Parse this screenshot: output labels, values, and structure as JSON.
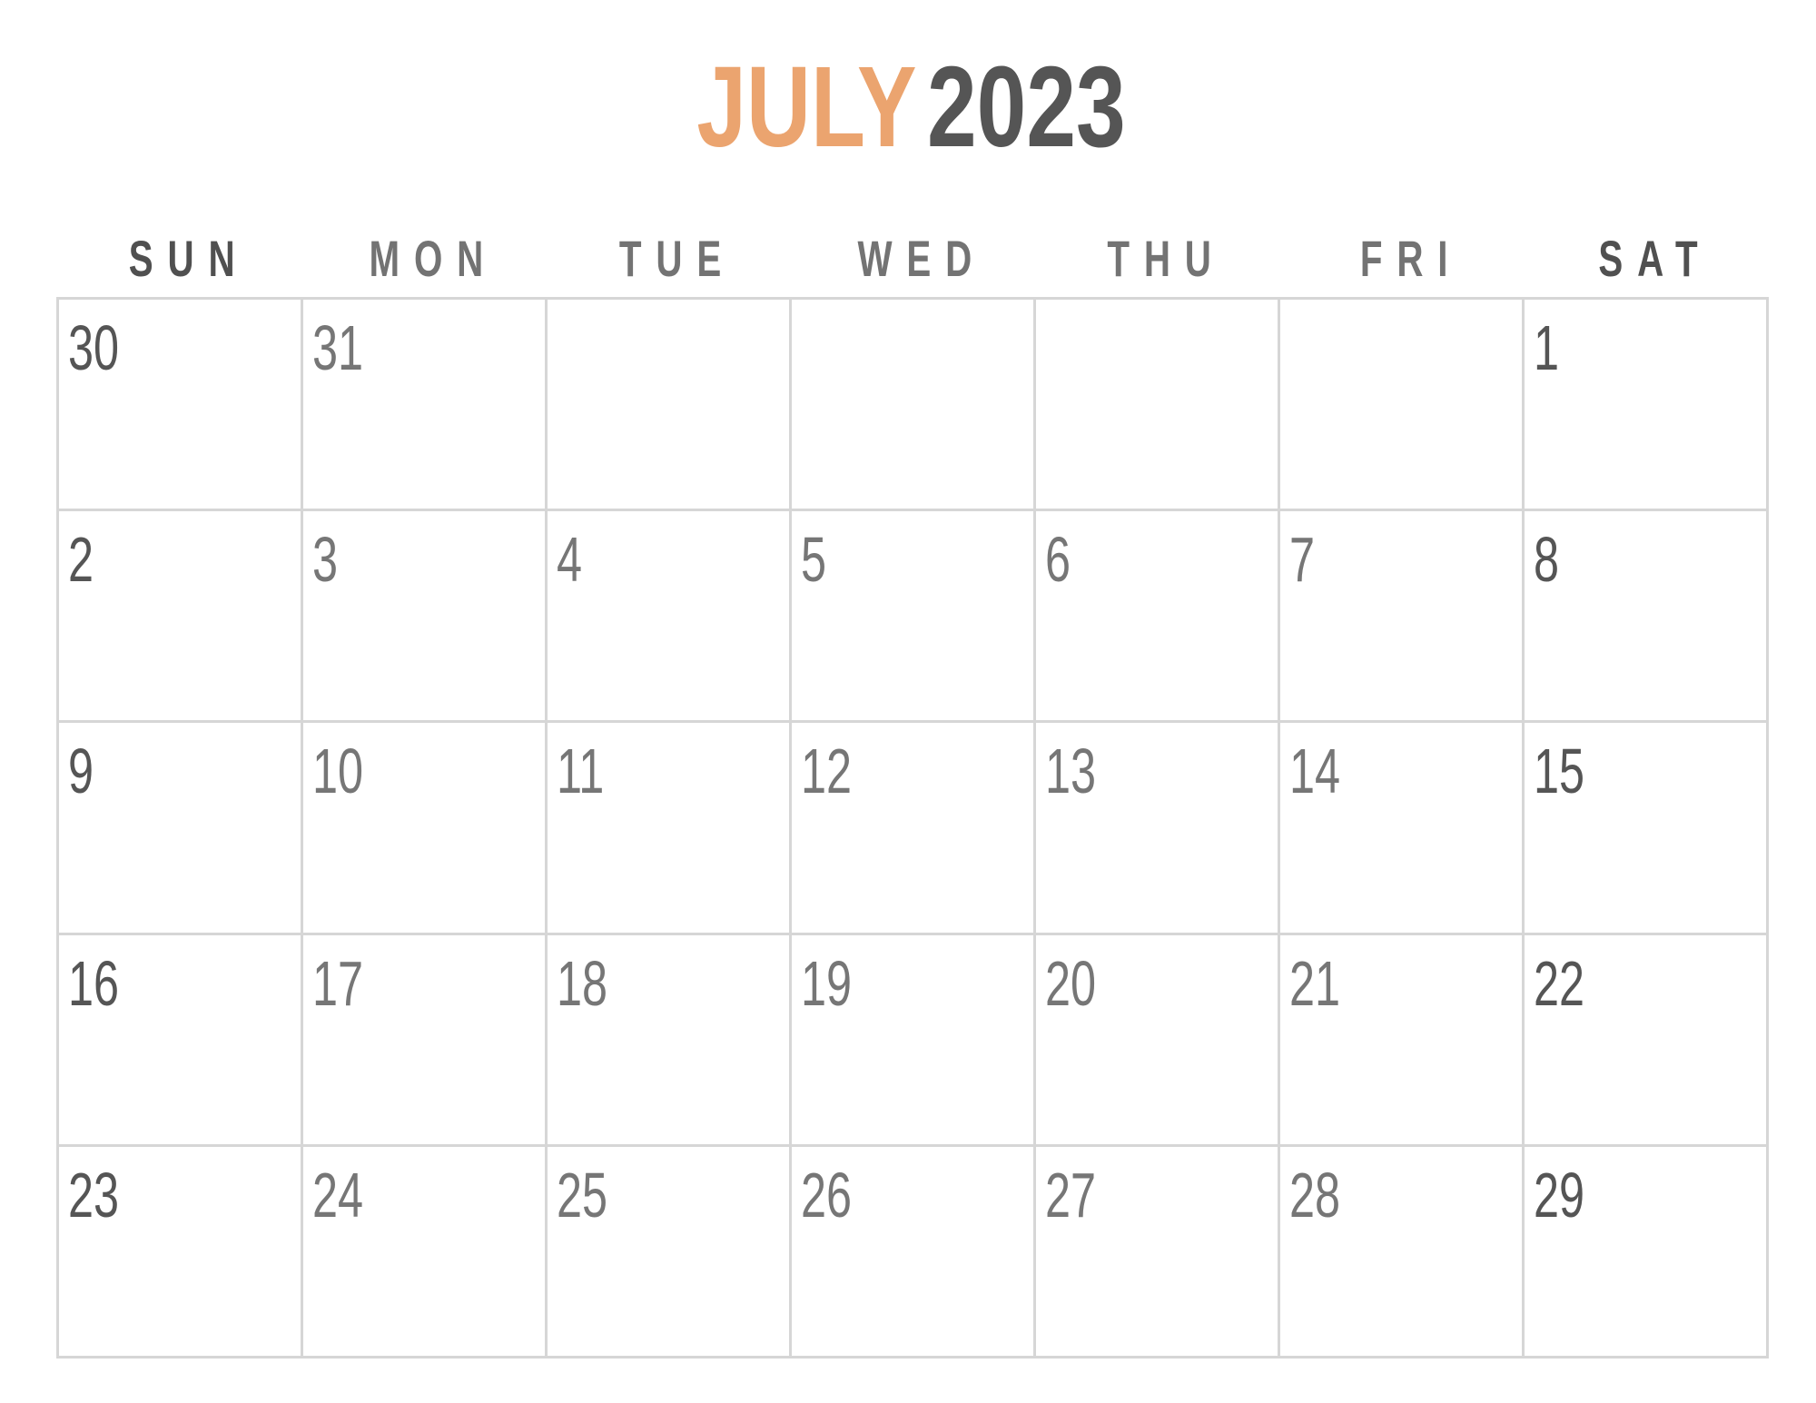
{
  "header": {
    "month": "JULY",
    "year": "2023"
  },
  "colors": {
    "month": "#eba46f",
    "year": "#555555",
    "weekday_dark": "#505050",
    "weekday_light": "#737373",
    "grid_line": "#d6d6d6",
    "day_dark": "#555555",
    "day_light": "#767676"
  },
  "weekdays": [
    {
      "label": "SUN",
      "tone": "dark"
    },
    {
      "label": "MON",
      "tone": "light"
    },
    {
      "label": "TUE",
      "tone": "light"
    },
    {
      "label": "WED",
      "tone": "light"
    },
    {
      "label": "THU",
      "tone": "light"
    },
    {
      "label": "FRI",
      "tone": "light"
    },
    {
      "label": "SAT",
      "tone": "dark"
    }
  ],
  "weeks": [
    [
      "30",
      "31",
      "",
      "",
      "",
      "",
      "1"
    ],
    [
      "2",
      "3",
      "4",
      "5",
      "6",
      "7",
      "8"
    ],
    [
      "9",
      "10",
      "11",
      "12",
      "13",
      "14",
      "15"
    ],
    [
      "16",
      "17",
      "18",
      "19",
      "20",
      "21",
      "22"
    ],
    [
      "23",
      "24",
      "25",
      "26",
      "27",
      "28",
      "29"
    ]
  ]
}
